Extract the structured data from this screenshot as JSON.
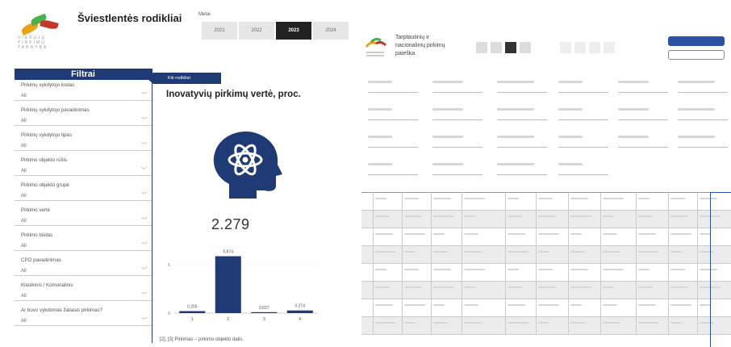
{
  "header": {
    "logo_text": "VIEŠŲJŲ PIRKIMŲ TARNYBA",
    "title": "Šviestlentės rodikliai",
    "year_label": "Metai",
    "years": [
      "2021",
      "2022",
      "2023",
      "2024"
    ],
    "selected_year": "2023"
  },
  "filters": {
    "title": "Filtrai",
    "items": [
      {
        "label": "Pirkimų vykdytojo kodas",
        "value": "All"
      },
      {
        "label": "Pirkimų vykdytojo pavadinimas",
        "value": "All"
      },
      {
        "label": "Pirkimų vykdytojo tipas",
        "value": "All"
      },
      {
        "label": "Pirkimo objekto rūšis",
        "value": "All"
      },
      {
        "label": "Pirkimo objekto grupė",
        "value": "All"
      },
      {
        "label": "Pirkimo vertė",
        "value": "All"
      },
      {
        "label": "Pirkimo būdas",
        "value": "All"
      },
      {
        "label": "CPO pavadinimas",
        "value": "All"
      },
      {
        "label": "Klasikinis / Komunalinis",
        "value": "All"
      },
      {
        "label": "Ar buvo vykdomas žaliasis pirkimas?",
        "value": "All"
      }
    ]
  },
  "main": {
    "back_button": "Kiti rodikliai",
    "title": "Inovatyvių pirkimų vertė, proc.",
    "icon": "innovation-head-atom-icon",
    "value": "2.279",
    "footnote": "[2], [3] Pirkimas – pirkimo objekto dalis."
  },
  "chart_data": {
    "type": "bar",
    "categories": [
      "1",
      "2",
      "3",
      "4"
    ],
    "values": [
      0.205,
      5.874,
      0.037,
      0.274
    ],
    "data_labels": [
      "0.205",
      "5.874",
      "0.037",
      "0.274"
    ],
    "yticks": [
      "0",
      "5"
    ],
    "ylim": [
      0,
      6.5
    ],
    "color": "#1f3a75"
  },
  "right_panel": {
    "title": "Tarptautinių ir nacionalinių pirkimų paieška",
    "accent": "#2952a3"
  }
}
